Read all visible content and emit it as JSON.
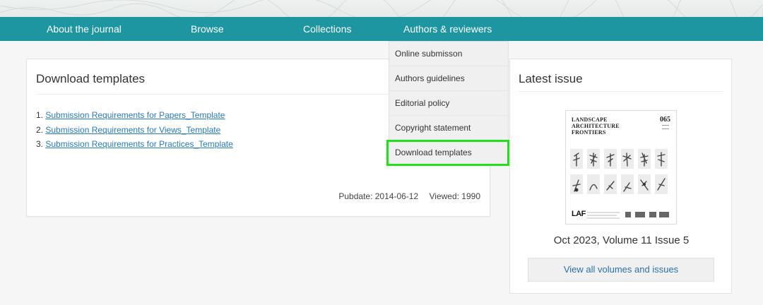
{
  "nav": {
    "about": "About the journal",
    "browse": "Browse",
    "collections": "Collections",
    "authors": "Authors & reviewers"
  },
  "dropdown": {
    "items": [
      "Online submisson",
      "Authors guidelines",
      "Editorial policy",
      "Copyright statement",
      "Download templates"
    ],
    "highlighted": "Download templates",
    "highlight_color": "#22e01a"
  },
  "main": {
    "title": "Download templates",
    "templates": [
      {
        "num": "1.",
        "label": "Submission Requirements for Papers_Template"
      },
      {
        "num": "2.",
        "label": "Submission Requirements for Views_Template"
      },
      {
        "num": "3.",
        "label": "Submission Requirements for Practices_Template"
      }
    ],
    "pubdate": "Pubdate: 2014-06-12",
    "viewed": "Viewed: 1990"
  },
  "sidebar": {
    "title": "Latest issue",
    "cover": {
      "title": "LANDSCAPE\nARCHITECTURE\nFRONTIERS",
      "issue_number": "065",
      "logo": "LAF"
    },
    "issue_caption": "Oct 2023, Volume 11 Issue 5",
    "view_all": "View all volumes and issues"
  },
  "colors": {
    "nav_bg": "#1e96a2",
    "link": "#2a7ab9"
  }
}
